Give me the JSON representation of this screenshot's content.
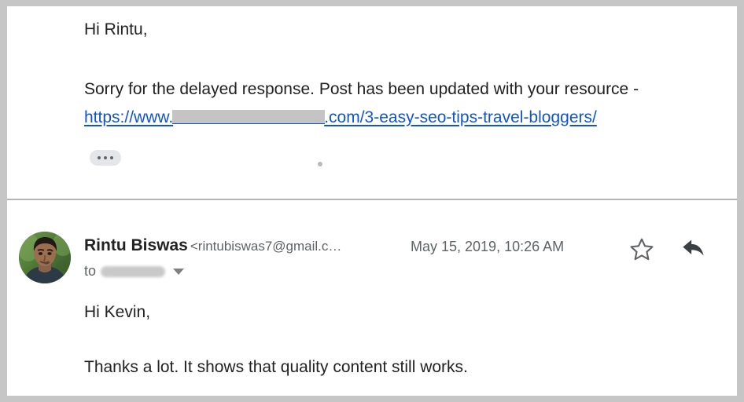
{
  "window": {
    "app": "gmail-email-thread"
  },
  "messages": [
    {
      "greeting": "Hi Rintu,",
      "paragraph": "Sorry for the delayed response. Post has been updated with your resource -",
      "link": {
        "prefix": "https://www.",
        "redacted": "",
        "suffix": ".com/3-easy-seo-tips-travel-bloggers/"
      },
      "trimmed_button_label": "•••"
    },
    {
      "sender_name": "Rintu Biswas",
      "sender_email": "<rintubiswas7@gmail.c…",
      "date": "May 15, 2019, 10:26 AM",
      "to_label": "to",
      "to_recipient_redacted": "",
      "greeting": "Hi Kevin,",
      "paragraph": "Thanks a lot. It shows that quality content still works."
    }
  ],
  "icons": {
    "star": "star-outline-icon",
    "reply": "reply-arrow-icon",
    "expand_recipients": "chevron-down-icon",
    "trimmed_content": "ellipsis-icon"
  },
  "colors": {
    "frame": "#c6c6c6",
    "page": "#ffffff",
    "link": "#1155cc",
    "text": "#222222",
    "muted": "#5f6368",
    "divider": "#b5b5b5",
    "redaction": "#c4c4c4"
  }
}
